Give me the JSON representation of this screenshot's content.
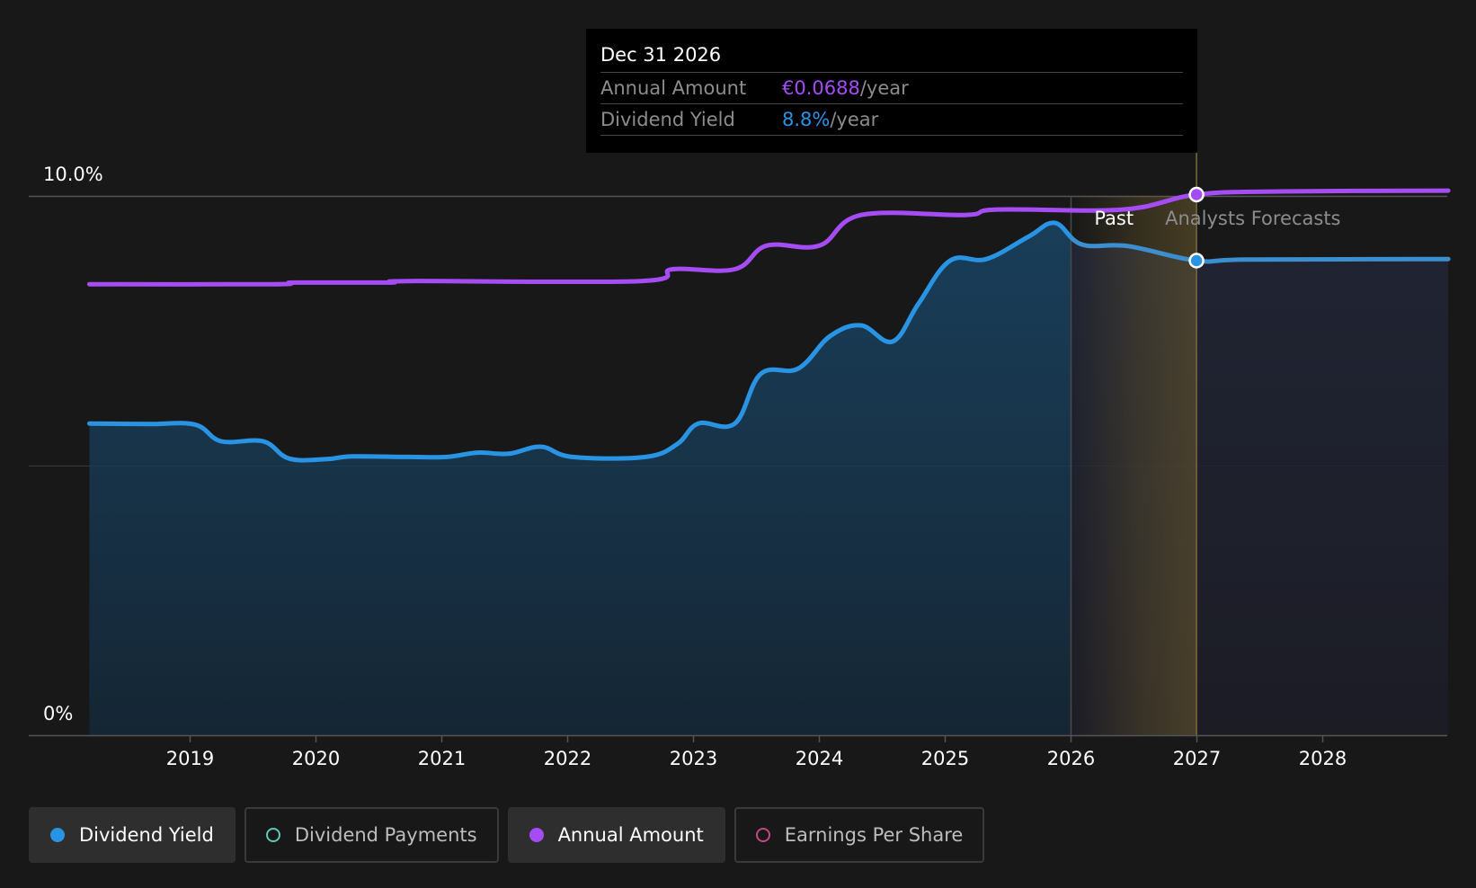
{
  "chart_data": {
    "type": "area",
    "y_tick_labels": [
      "10.0%",
      "0%"
    ],
    "ylim": [
      0,
      10
    ],
    "x_tick_labels": [
      "2019",
      "2020",
      "2021",
      "2022",
      "2023",
      "2024",
      "2025",
      "2026",
      "2027",
      "2028"
    ],
    "region_labels": {
      "past": "Past",
      "forecast": "Analysts Forecasts"
    },
    "past_end_date": "2026-01-01",
    "highlight_date": "2026-12-31",
    "grid": true,
    "series": [
      {
        "name": "Dividend Yield",
        "color": "#2994e3",
        "unit": "%",
        "points": [
          [
            "2018-03-15",
            5.78
          ],
          [
            "2018-09-01",
            5.77
          ],
          [
            "2019-01-15",
            5.76
          ],
          [
            "2019-04-01",
            5.45
          ],
          [
            "2019-08-01",
            5.45
          ],
          [
            "2019-10-15",
            5.13
          ],
          [
            "2020-02-01",
            5.12
          ],
          [
            "2020-04-15",
            5.17
          ],
          [
            "2020-10-01",
            5.16
          ],
          [
            "2021-01-15",
            5.16
          ],
          [
            "2021-04-15",
            5.24
          ],
          [
            "2021-07-15",
            5.22
          ],
          [
            "2021-10-15",
            5.35
          ],
          [
            "2022-01-15",
            5.16
          ],
          [
            "2022-08-15",
            5.16
          ],
          [
            "2022-11-15",
            5.4
          ],
          [
            "2023-01-15",
            5.78
          ],
          [
            "2023-05-01",
            5.78
          ],
          [
            "2023-07-15",
            6.7
          ],
          [
            "2023-11-01",
            6.8
          ],
          [
            "2024-02-01",
            7.4
          ],
          [
            "2024-05-01",
            7.6
          ],
          [
            "2024-08-01",
            7.3
          ],
          [
            "2024-10-15",
            8.0
          ],
          [
            "2025-01-15",
            8.8
          ],
          [
            "2025-05-01",
            8.83
          ],
          [
            "2025-09-01",
            9.25
          ],
          [
            "2025-11-15",
            9.5
          ],
          [
            "2026-02-01",
            9.1
          ],
          [
            "2026-06-15",
            9.07
          ],
          [
            "2026-12-31",
            8.8
          ],
          [
            "2027-06-01",
            8.82
          ],
          [
            "2028-12-31",
            8.83
          ]
        ]
      },
      {
        "name": "Annual Amount",
        "color": "#a64cf5",
        "unit": "EUR/year",
        "points": [
          [
            "2018-03-15",
            0.0574
          ],
          [
            "2019-09-01",
            0.0574
          ],
          [
            "2019-11-01",
            0.0576
          ],
          [
            "2020-08-01",
            0.0576
          ],
          [
            "2020-10-01",
            0.0578
          ],
          [
            "2022-08-01",
            0.0578
          ],
          [
            "2022-11-01",
            0.0593
          ],
          [
            "2023-05-01",
            0.0593
          ],
          [
            "2023-08-01",
            0.0623
          ],
          [
            "2024-01-01",
            0.0623
          ],
          [
            "2024-05-01",
            0.0662
          ],
          [
            "2025-03-01",
            0.0662
          ],
          [
            "2025-06-01",
            0.0669
          ],
          [
            "2026-06-01",
            0.0669
          ],
          [
            "2026-12-31",
            0.0688
          ],
          [
            "2027-09-01",
            0.0692
          ],
          [
            "2028-12-31",
            0.0693
          ]
        ]
      }
    ]
  },
  "tooltip": {
    "date": "Dec 31 2026",
    "rows": [
      {
        "label": "Annual Amount",
        "value": "€0.0688",
        "unit": "/year"
      },
      {
        "label": "Dividend Yield",
        "value": "8.8%",
        "unit": "/year"
      }
    ]
  },
  "legend": [
    {
      "label": "Dividend Yield",
      "active": true,
      "marker": "filled",
      "color": "#2994e3"
    },
    {
      "label": "Dividend Payments",
      "active": false,
      "marker": "ring",
      "color": "#5fc8b8"
    },
    {
      "label": "Annual Amount",
      "active": true,
      "marker": "filled",
      "color": "#a64cf5"
    },
    {
      "label": "Earnings Per Share",
      "active": false,
      "marker": "ring",
      "color": "#c04a86"
    }
  ]
}
